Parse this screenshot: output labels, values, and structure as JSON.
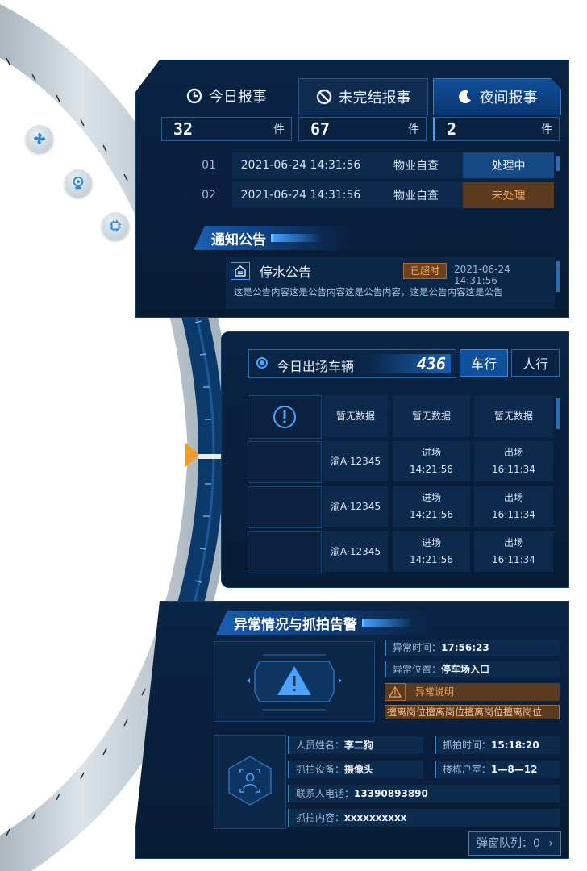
{
  "tabs": [
    {
      "label": "今日报事",
      "icon": "clock-icon",
      "count": "32",
      "unit": "件"
    },
    {
      "label": "未完结报事",
      "icon": "prohibit-icon",
      "count": "67",
      "unit": "件"
    },
    {
      "label": "夜间报事",
      "icon": "moon-icon",
      "count": "2",
      "unit": "件"
    }
  ],
  "reports": [
    {
      "no": "01",
      "datetime": "2021-06-24 14:31:56",
      "source": "物业自查",
      "status": "处理中"
    },
    {
      "no": "02",
      "datetime": "2021-06-24 14:31:56",
      "source": "物业自查",
      "status": "未处理"
    }
  ],
  "notice": {
    "section_title": "通知公告",
    "title": "停水公告",
    "badge": "已超时",
    "time": "2021-06-24 14:31:56",
    "body": "这是公告内容这是公告内容这是公告内容，这是公告内容这是公告"
  },
  "vehicles": {
    "today_label": "今日出场车辆",
    "today_value": "436",
    "tab_car": "车行",
    "tab_ped": "人行",
    "header_cells": [
      "暂无数据",
      "暂无数据",
      "暂无数据"
    ],
    "rows": [
      {
        "plate": "渝A·12345",
        "in_label": "进场",
        "in_time": "14:21:56",
        "out_label": "出场",
        "out_time": "16:11:34"
      },
      {
        "plate": "渝A·12345",
        "in_label": "进场",
        "in_time": "14:21:56",
        "out_label": "出场",
        "out_time": "16:11:34"
      },
      {
        "plate": "渝A·12345",
        "in_label": "进场",
        "in_time": "14:21:56",
        "out_label": "出场",
        "out_time": "16:11:34"
      }
    ]
  },
  "alerts": {
    "section_title": "异常情况与抓拍告警",
    "abnormal_time_label": "异常时间：",
    "abnormal_time": "17:56:23",
    "abnormal_place_label": "异常位置：",
    "abnormal_place": "停车场入口",
    "abnormal_desc_label": "异常说明",
    "abnormal_desc": "擅离岗位擅离岗位擅离岗位擅离岗位",
    "person_name_label": "人员姓名：",
    "person_name": "李二狗",
    "capture_time_label": "抓拍时间：",
    "capture_time": "15:18:20",
    "device_label": "抓拍设备：",
    "device": "摄像头",
    "room_label": "楼栋户室：",
    "room": "1—8—12",
    "phone_label": "联系人电话：",
    "phone": "13390893890",
    "content_label": "抓拍内容：",
    "content": "xxxxxxxxxx",
    "queue_label": "弹窗队列：",
    "queue_count": "0"
  },
  "side_icons": [
    "fan-icon",
    "camera-icon",
    "chip-icon"
  ],
  "colors": {
    "panel_bg": "#071b35",
    "accent": "#1a5fb3",
    "warning": "#f49a28",
    "pending": "#f0a65b"
  }
}
